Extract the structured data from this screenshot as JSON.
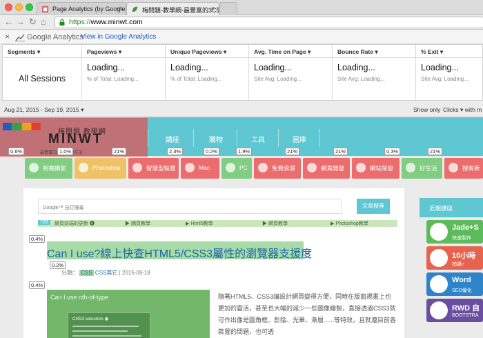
{
  "browser": {
    "tabs": [
      {
        "title": "Page Analytics (by Google) -",
        "active": false
      },
      {
        "title": "梅問題-教學網-最豐富的3C問",
        "active": true
      }
    ],
    "url": "https://www.minwt.com",
    "url_scheme": "https://",
    "url_host": "www.minwt.com",
    "close_glyph": "×",
    "back_glyph": "←",
    "forward_glyph": "→",
    "reload_glyph": "↻",
    "home_glyph": "⌂"
  },
  "ga": {
    "close_glyph": "×",
    "product_name": "Google Analytics",
    "view_link": "View in Google Analytics"
  },
  "metrics": {
    "segments_header": "Segments",
    "segment_value": "All Sessions",
    "columns": [
      {
        "header": "Pageviews",
        "value": "Loading...",
        "sub": "% of Total: Loading..."
      },
      {
        "header": "Unique Pageviews",
        "value": "Loading...",
        "sub": "% of Total: Loading..."
      },
      {
        "header": "Avg. Time on Page",
        "value": "Loading...",
        "sub": "Site Avg: Loading..."
      },
      {
        "header": "Bounce Rate",
        "value": "Loading...",
        "sub": "Site Avg: Loading..."
      },
      {
        "header": "% Exit",
        "value": "Loading...",
        "sub": "Site Avg: Loading..."
      }
    ],
    "dropdown_glyph": "▾"
  },
  "datebar": {
    "range": "Aug 21, 2015 - Sep 19, 2015",
    "show_only": "Show only",
    "clicks": "Clicks",
    "with": "with m"
  },
  "site": {
    "logo_title": "梅問題 教學網",
    "logo_main": "MINWT",
    "logo_sub": "最豐富的3C問題全在這",
    "swatch_colors": [
      "#1f5fbf",
      "#2fa24a",
      "#f0a020",
      "#e04030"
    ],
    "menu": [
      "講座",
      "購物",
      "工具",
      "圖庫"
    ],
    "overlay_badges": [
      "0.6%",
      "1.0%",
      "21%",
      "2.3%",
      "0.2%",
      "1.9%",
      "21%",
      "21%",
      "0.3%",
      "21%"
    ],
    "categories": [
      {
        "label": "相機攝影",
        "color": "rgba(110,200,110,0.85)"
      },
      {
        "label": "Photoshop",
        "color": "rgba(240,190,90,0.9)"
      },
      {
        "label": "智慧型裝置",
        "color": "rgba(235,95,95,0.9)"
      },
      {
        "label": "Mac",
        "color": "rgba(235,95,95,0.9)"
      },
      {
        "label": "PC",
        "color": "rgba(110,200,110,0.85)"
      },
      {
        "label": "免費資源",
        "color": "rgba(235,95,95,0.9)"
      },
      {
        "label": "網頁開發",
        "color": "rgba(235,95,95,0.9)"
      },
      {
        "label": "網站架設",
        "color": "rgba(235,95,95,0.9)"
      },
      {
        "label": "好生活",
        "color": "rgba(110,200,110,0.85)"
      },
      {
        "label": "搜有新",
        "color": "rgba(235,95,95,0.9)"
      }
    ],
    "search_placeholder": "Google™ 自訂搜尋",
    "search_button": "文章搜尋",
    "tags": {
      "count": "728",
      "items": [
        "網頁前端的更新 ❻",
        "▶ 網頁教學",
        "▶ Html5教學",
        "▶ 網頁教學",
        "▶ Photoshop教學"
      ]
    },
    "post": {
      "badge_title": "0.4%",
      "title": "Can I use?線上快查HTML5/CSS3屬性的瀏覽器支援度",
      "badge_meta": "0.2%",
      "meta_prefix": "分類：",
      "meta_css": "CSS",
      "meta_css_other": "CSS其它",
      "meta_date": "| 2015-09-18",
      "badge_thumb": "0.4%",
      "thumb_title": "Can I use        nth-of-type",
      "thumb_panel_title": "CSS3 selectors ◉",
      "excerpt": "隨著HTML5、CSS3讓設計網頁變得方便，同時在版面規畫上也更加的靈活，甚至也大幅的減少一些圖像繪製，直接透過CSS3就可作出像是圓角框、影陰、光暈、漸層......等特效，且就連目前各裝置的問題，也可透"
    },
    "sidebar": {
      "title": "近期講座",
      "ads": [
        {
          "line1": "Jade+S",
          "line2": "快速製作",
          "color": "#5dbb5d"
        },
        {
          "line1": "10小時",
          "line2": "拍攝+",
          "color": "#e8634f"
        },
        {
          "line1": "Word",
          "line2": "SEO優化",
          "color": "#2f83c8"
        },
        {
          "line1": "RWD 自",
          "line2": "BOOTSTRA",
          "color": "#6a4fa0"
        }
      ]
    }
  }
}
